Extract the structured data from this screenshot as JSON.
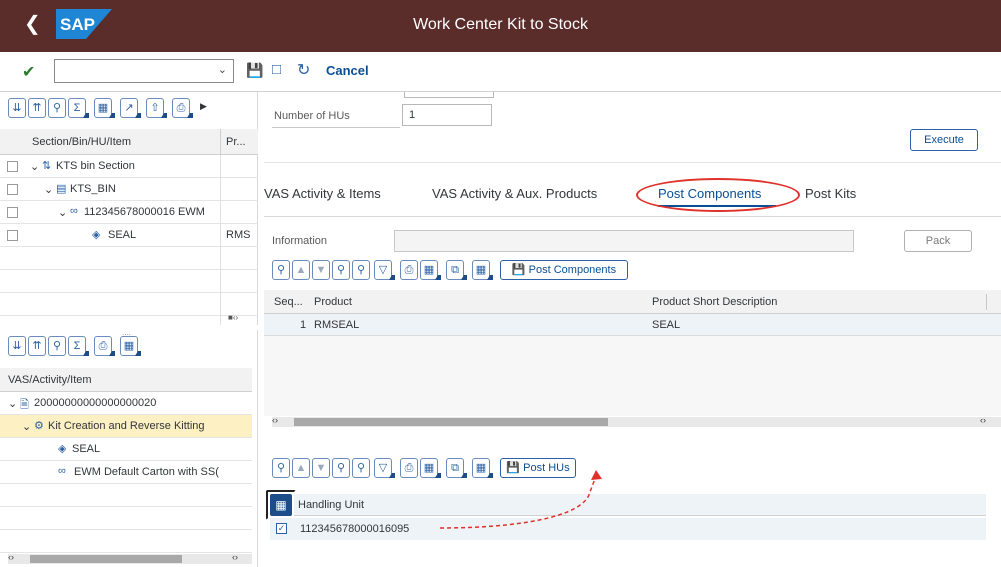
{
  "window": {
    "title": "Work Center Kit to Stock",
    "logo_text": "SAP"
  },
  "toolbar": {
    "cancel_label": "Cancel"
  },
  "left_top": {
    "headers": [
      "Section/Bin/HU/Item",
      "Pr..."
    ],
    "rows": [
      {
        "label": "KTS bin Section",
        "col2": ""
      },
      {
        "label": "KTS_BIN",
        "col2": ""
      },
      {
        "label": "112345678000016 EWM",
        "col2": ""
      },
      {
        "label": "SEAL",
        "col2": "RMS"
      }
    ]
  },
  "left_bottom": {
    "header": "VAS/Activity/Item",
    "rows": [
      {
        "label": "20000000000000000020"
      },
      {
        "label": "Kit Creation and Reverse Kitting"
      },
      {
        "label": "SEAL"
      },
      {
        "label": "EWM Default Carton with SS("
      }
    ]
  },
  "form": {
    "hus_label": "Number of HUs",
    "hus_value": "1",
    "execute_label": "Execute"
  },
  "tabs": [
    "VAS Activity & Items",
    "VAS Activity & Aux. Products",
    "Post Components",
    "Post Kits"
  ],
  "info": {
    "label": "Information",
    "pack_label": "Pack"
  },
  "components": {
    "post_label": "Post Components",
    "headers": [
      "Seq...",
      "Product",
      "Product Short Description"
    ],
    "rows": [
      {
        "seq": "1",
        "product": "RMSEAL",
        "desc": "SEAL"
      }
    ]
  },
  "hus": {
    "post_label": "Post HUs",
    "header": "Handling Unit",
    "rows": [
      {
        "hu": "112345678000016095"
      }
    ]
  },
  "colors": {
    "titlebar": "#5a2c2a",
    "accent": "#0a4e94",
    "annotation": "#e0302a",
    "highlight": "#fdf0c2"
  }
}
